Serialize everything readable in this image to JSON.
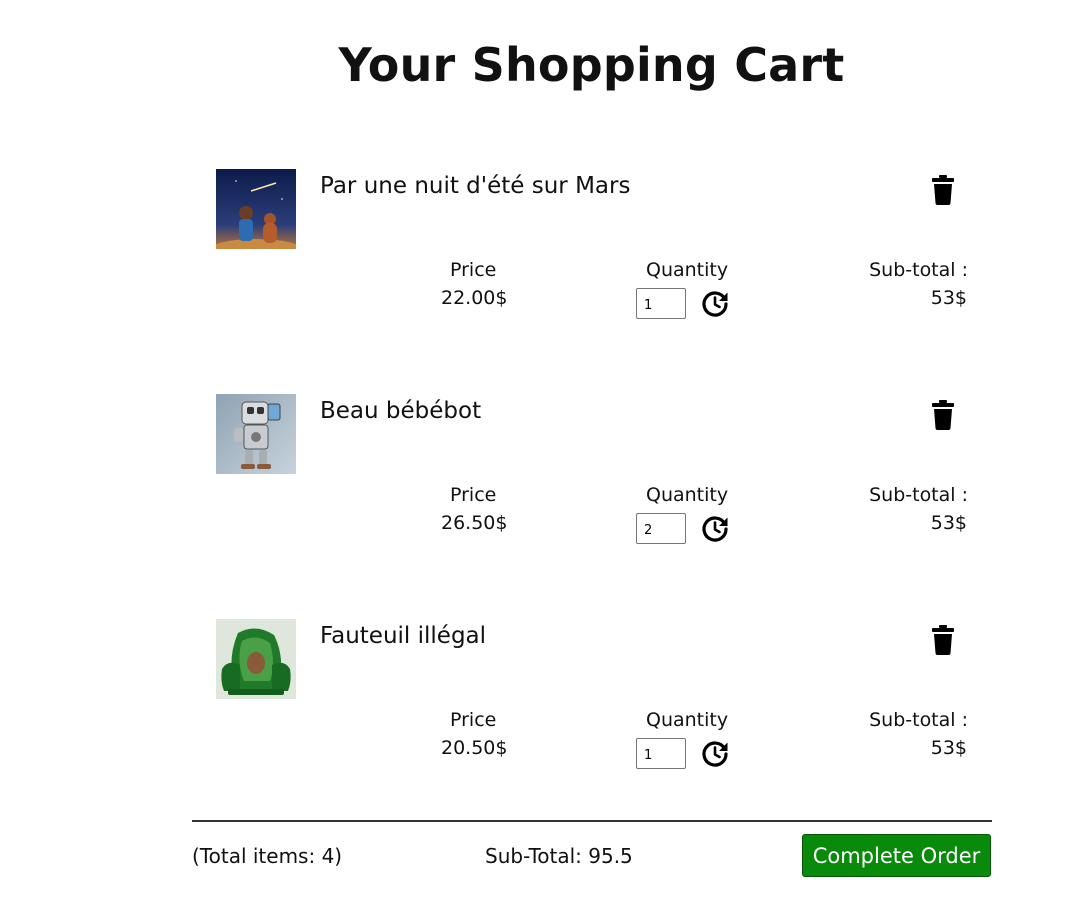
{
  "page": {
    "title": "Your Shopping Cart"
  },
  "cart": {
    "price_label": "Price",
    "quantity_label": "Quantity",
    "subtotal_label": "Sub-total :",
    "items": [
      {
        "name": "Par une nuit d'été sur Mars",
        "price": "22.00$",
        "quantity": "1",
        "subtotal": "53$",
        "image_icon": "boy-and-dog-under-night-sky"
      },
      {
        "name": "Beau bébébot",
        "price": "26.50$",
        "quantity": "2",
        "subtotal": "53$",
        "image_icon": "little-robot"
      },
      {
        "name": "Fauteuil illégal",
        "price": "20.50$",
        "quantity": "1",
        "subtotal": "53$",
        "image_icon": "avocado-armchair"
      }
    ]
  },
  "footer": {
    "total_items": "(Total items: 4)",
    "subtotal": "Sub-Total: 95.5",
    "complete_button": "Complete Order"
  },
  "colors": {
    "complete_button_bg": "#0a8a0a",
    "text": "#111111"
  }
}
